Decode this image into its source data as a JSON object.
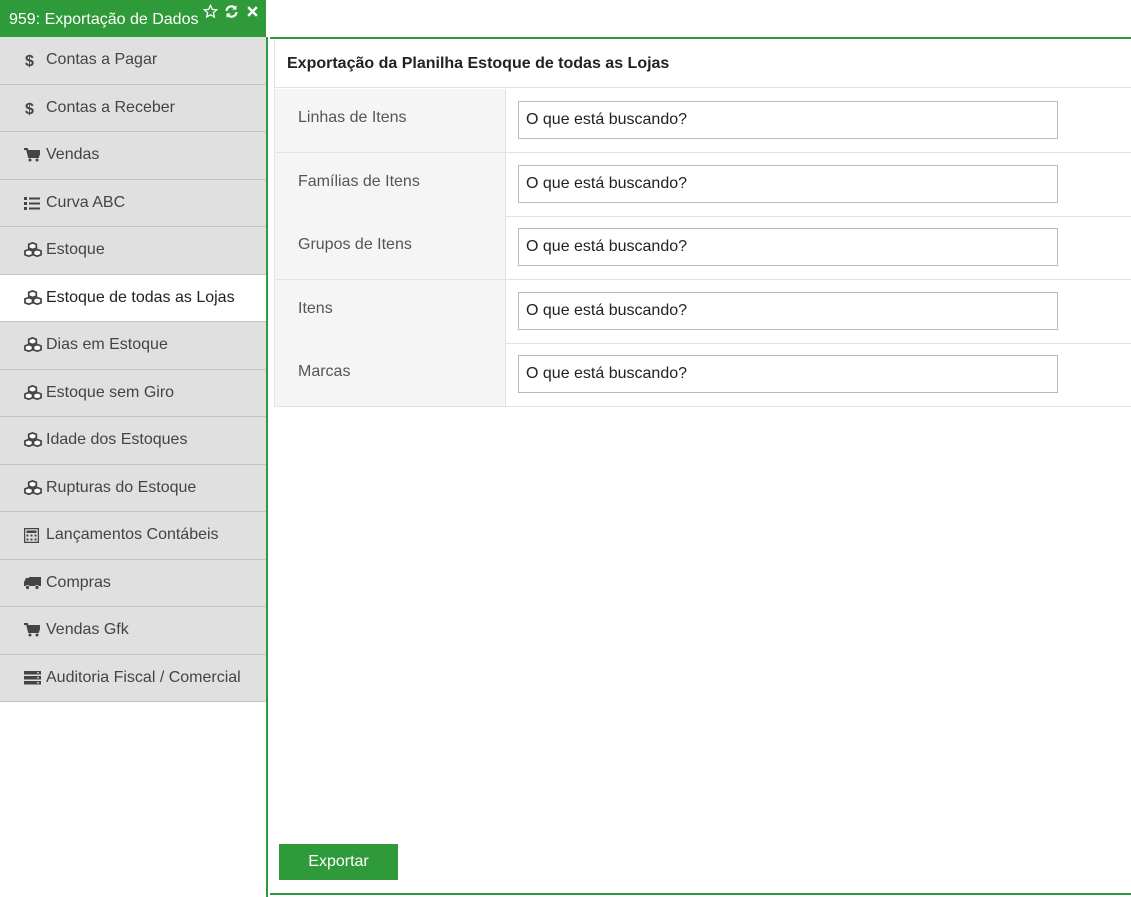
{
  "tab": {
    "title": "959: Exportação de Dados",
    "icons": [
      "star-outline-icon",
      "refresh-icon",
      "close-icon"
    ],
    "color": "#2e9a39"
  },
  "sidebar": {
    "items": [
      {
        "label": "Contas a Pagar",
        "icon": "dollar-icon"
      },
      {
        "label": "Contas a Receber",
        "icon": "dollar-icon"
      },
      {
        "label": "Vendas",
        "icon": "cart-icon"
      },
      {
        "label": "Curva ABC",
        "icon": "list-icon"
      },
      {
        "label": "Estoque",
        "icon": "cubes-icon"
      },
      {
        "label": "Estoque de todas as Lojas",
        "icon": "cubes-icon",
        "active": true
      },
      {
        "label": "Dias em Estoque",
        "icon": "cubes-icon"
      },
      {
        "label": "Estoque sem Giro",
        "icon": "cubes-icon"
      },
      {
        "label": "Idade dos Estoques",
        "icon": "cubes-icon"
      },
      {
        "label": "Rupturas do Estoque",
        "icon": "cubes-icon"
      },
      {
        "label": "Lançamentos Contábeis",
        "icon": "calculator-icon"
      },
      {
        "label": "Compras",
        "icon": "truck-icon"
      },
      {
        "label": "Vendas Gfk",
        "icon": "cart-icon"
      },
      {
        "label": "Auditoria Fiscal / Comercial",
        "icon": "server-icon"
      }
    ]
  },
  "main": {
    "title": "Exportação da Planilha Estoque de todas as Lojas",
    "fields": [
      {
        "label": "Linhas de Itens",
        "placeholder": "O que está buscando?"
      },
      {
        "label": "Famílias de Itens",
        "placeholder": "O que está buscando?"
      },
      {
        "label": "Grupos de Itens",
        "placeholder": "O que está buscando?"
      },
      {
        "label": "Itens",
        "placeholder": "O que está buscando?"
      },
      {
        "label": "Marcas",
        "placeholder": "O que está buscando?"
      }
    ],
    "export_label": "Exportar"
  }
}
